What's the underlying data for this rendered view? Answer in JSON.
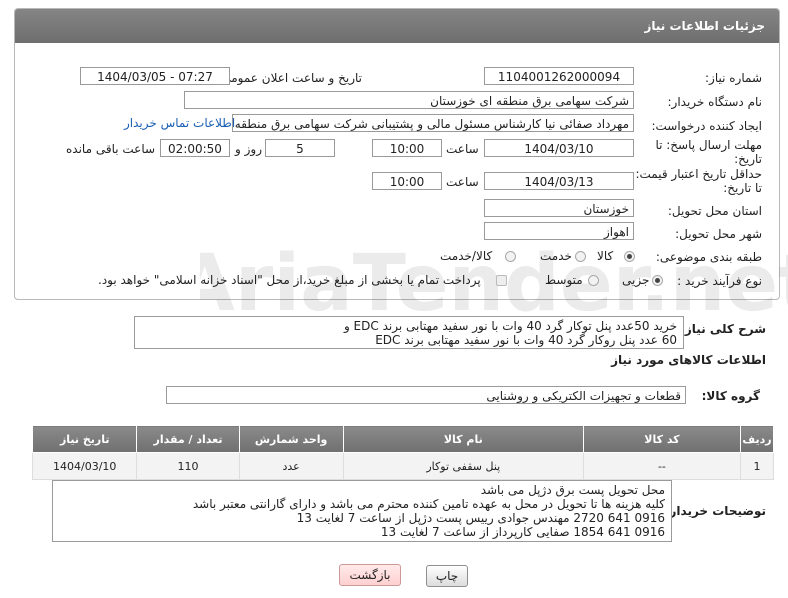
{
  "panel_title": "جزئیات اطلاعات نیاز",
  "fields": {
    "need_number_label": "شماره نیاز:",
    "need_number": "1104001262000094",
    "announce_label": "تاریخ و ساعت اعلان عمومی:",
    "announce_value": "1404/03/05 - 07:27",
    "buyer_org_label": "نام دستگاه خریدار:",
    "buyer_org": "شرکت سهامی برق منطقه ای خوزستان",
    "creator_label": "ایجاد کننده درخواست:",
    "creator": "مهرداد صفائی نیا کارشناس مسئول مالی و پشتیبانی شرکت سهامی برق منطقه ای خوزستان",
    "contact_link": "اطلاعات تماس خریدار",
    "deadline_label_1": "مهلت ارسال پاسخ: تا",
    "deadline_label_2": "تاریخ:",
    "deadline_date": "1404/03/10",
    "time_word": "ساعت",
    "deadline_time": "10:00",
    "days_value": "5",
    "days_word": "روز و",
    "remaining_time": "02:00:50",
    "remaining_word": "ساعت باقی مانده",
    "price_label_1": "حداقل تاریخ اعتبار قیمت:",
    "price_label_2": "تا تاریخ:",
    "price_date": "1404/03/13",
    "price_time": "10:00",
    "province_label": "استان محل تحویل:",
    "province": "خوزستان",
    "city_label": "شهر محل تحویل:",
    "city": "اهواز",
    "category_label": "طبقه بندی موضوعی:",
    "category_options": [
      "کالا",
      "خدمت",
      "کالا/خدمت"
    ],
    "category_selected": "کالا",
    "process_label": "نوع فرآیند خرید :",
    "process_options": [
      "جزیی",
      "متوسط"
    ],
    "process_selected": "جزیی",
    "payment_note": "پرداخت تمام یا بخشی از مبلغ خرید،از محل \"اسناد خزانه اسلامی\" خواهد بود."
  },
  "summary": {
    "label": "شرح کلی نیاز:",
    "text": "خرید 50عدد پنل توکار  گرد 40 وات  با نور سفید مهتابی برند EDC و\n60 عدد پنل روکار گرد 40 وات  با نور سفید مهتابی برند EDC"
  },
  "goods_section_title": "اطلاعات کالاهای مورد نیاز",
  "goods_group_label": "گروه کالا:",
  "goods_group": "قطعات و تجهیزات الکتریکی و روشنایی",
  "table": {
    "headers": [
      "ردیف",
      "کد کالا",
      "نام کالا",
      "واحد شمارش",
      "تعداد / مقدار",
      "تاریخ نیاز"
    ],
    "rows": [
      [
        "1",
        "--",
        "پنل سقفی توکار",
        "عدد",
        "110",
        "1404/03/10"
      ]
    ]
  },
  "buyer_notes": {
    "label": "توضیحات خریدار:",
    "text": "محل تحویل پست برق دژپل می باشد\nکلیه هزینه ها تا تحویل در محل به عهده تامین کننده محترم می باشد و دارای گارانتی معتبر باشد\n0916 641 2720    مهندس جوادی   رییس پست دژپل از ساعت 7  لغایت 13\n0916 641 1854    صفایی   کارپرداز از ساعت 7 لغایت 13"
  },
  "buttons": {
    "print": "چاپ",
    "back": "بازگشت"
  },
  "watermark_text": "AriaTender.net"
}
